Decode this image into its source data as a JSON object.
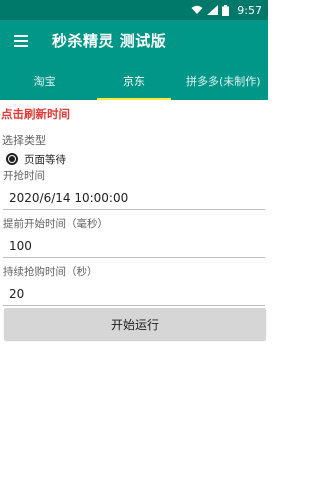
{
  "status_bar": {
    "time": "9:57"
  },
  "app_bar": {
    "title": "秒杀精灵 测试版"
  },
  "tabs": [
    {
      "label": "淘宝"
    },
    {
      "label": "京东"
    },
    {
      "label": "拼多多(未制作)"
    }
  ],
  "main": {
    "refresh_link": "点击刷新时间",
    "select_type_label": "选择类型",
    "radio_option": "页面等待",
    "start_time_label": "开抢时间",
    "start_time_value": "2020/6/14 10:00:00",
    "advance_label": "提前开始时间（毫秒）",
    "advance_value": "100",
    "duration_label": "持续抢购时间（秒）",
    "duration_value": "20",
    "start_button": "开始运行"
  },
  "colors": {
    "primary": "#009688",
    "status": "#00796b",
    "indicator": "#ffeb3b",
    "accent_text": "#e53935"
  }
}
